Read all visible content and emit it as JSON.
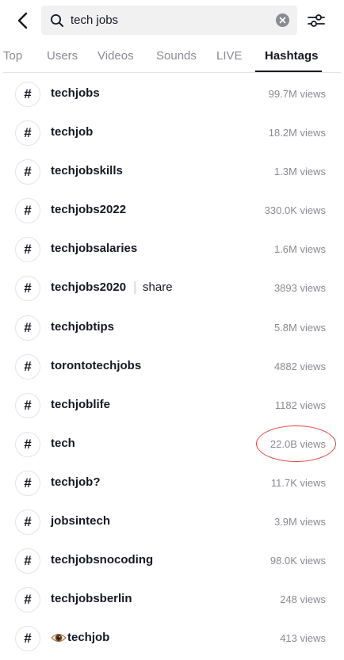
{
  "search": {
    "query": "tech jobs"
  },
  "tabs": [
    {
      "label": "Top"
    },
    {
      "label": "Users"
    },
    {
      "label": "Videos"
    },
    {
      "label": "Sounds"
    },
    {
      "label": "LIVE"
    },
    {
      "label": "Hashtags"
    }
  ],
  "hashtags": [
    {
      "symbol": "#",
      "name": "techjobs",
      "views": "99.7M views"
    },
    {
      "symbol": "#",
      "name": "techjob",
      "views": "18.2M views"
    },
    {
      "symbol": "#",
      "name": "techjobskills",
      "views": "1.3M views"
    },
    {
      "symbol": "#",
      "name": "techjobs2022",
      "views": "330.0K views"
    },
    {
      "symbol": "#",
      "name": "techjobsalaries",
      "views": "1.6M views"
    },
    {
      "symbol": "#",
      "name": "techjobs2020",
      "extra": "share",
      "views": "3893 views"
    },
    {
      "symbol": "#",
      "name": "techjobtips",
      "views": "5.8M views"
    },
    {
      "symbol": "#",
      "name": "torontotechjobs",
      "views": "4882 views"
    },
    {
      "symbol": "#",
      "name": "techjoblife",
      "views": "1182 views"
    },
    {
      "symbol": "#",
      "name": "tech",
      "views": "22.0B views"
    },
    {
      "symbol": "#",
      "name": "techjob?",
      "views": "11.7K views"
    },
    {
      "symbol": "#",
      "name": "jobsintech",
      "views": "3.9M views"
    },
    {
      "symbol": "#",
      "name": "techjobsnocoding",
      "views": "98.0K views"
    },
    {
      "symbol": "#",
      "name": "techjobsberlin",
      "views": "248 views"
    },
    {
      "symbol": "#",
      "name": "techjob",
      "prefix_icon": "eye-emoji-icon",
      "views": "413 views"
    }
  ],
  "colors": {
    "accent_text": "#161823",
    "muted_text": "#8a8b91",
    "annotation_circle": "#e0453f"
  }
}
